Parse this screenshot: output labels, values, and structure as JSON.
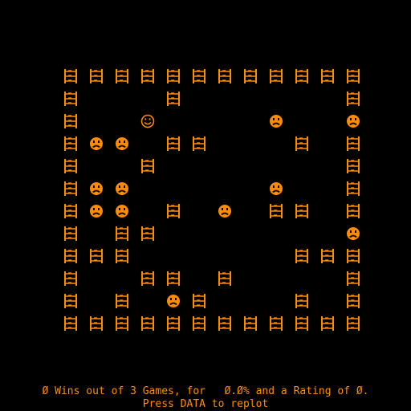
{
  "colors": {
    "background": "#000000",
    "foreground": "#ff8c00"
  },
  "legend": {
    "W": "fence-wall-icon",
    "P": "smiley-player-icon",
    "E": "frowny-enemy-icon",
    ".": "empty"
  },
  "board": [
    "WWWWWWWWWWWW",
    "W...W......W",
    "W..P....E..E",
    "WEE.WW...W.W",
    "W..W.......W",
    "WEE.....E..W",
    "WEE.W.E.WW.W",
    "W.WW.......E",
    "WWW......WWW",
    "W..WW.W....W",
    "W.W.EW...W.W",
    "WWWWWWWWWWWW"
  ],
  "status": {
    "line1": "Ø Wins out of 3 Games, for   Ø.Ø% and a Rating of Ø.",
    "line2": "Press DATA to replot"
  }
}
